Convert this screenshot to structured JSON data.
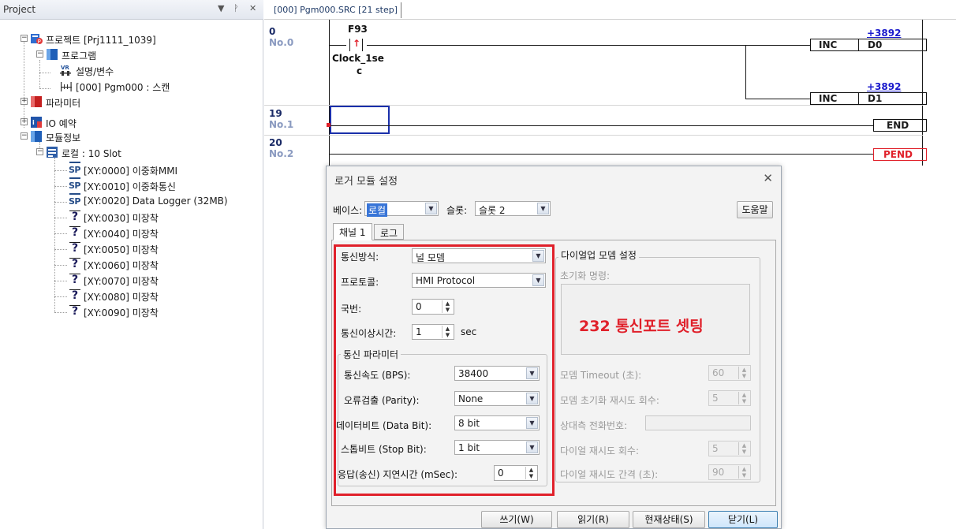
{
  "project_panel": {
    "title": "Project",
    "pin_glyph": "▾ ⊥ ✕",
    "tree": {
      "root": "프로젝트 [Prj1111_1039]",
      "program": "프로그램",
      "desc_vars": "설명/변수",
      "scan_program": "[000] Pgm000 : 스캔",
      "parameter": "파라미터",
      "io_reserve": "IO 예약",
      "module_info": "모듈정보",
      "local_base": "로컬 : 10 Slot",
      "slots": [
        {
          "label": "[XY:0000] 이중화MMI",
          "icon": "sp-module-icon"
        },
        {
          "label": "[XY:0010] 이중화통신",
          "icon": "sp-module-icon"
        },
        {
          "label": "[XY:0020] Data Logger (32MB)",
          "icon": "sp-module-icon"
        },
        {
          "label": "[XY:0030] 미장착",
          "icon": "unknown-module-icon"
        },
        {
          "label": "[XY:0040] 미장착",
          "icon": "unknown-module-icon"
        },
        {
          "label": "[XY:0050] 미장착",
          "icon": "unknown-module-icon"
        },
        {
          "label": "[XY:0060] 미장착",
          "icon": "unknown-module-icon"
        },
        {
          "label": "[XY:0070] 미장착",
          "icon": "unknown-module-icon"
        },
        {
          "label": "[XY:0080] 미장착",
          "icon": "unknown-module-icon"
        },
        {
          "label": "[XY:0090] 미장착",
          "icon": "unknown-module-icon"
        }
      ],
      "sp_glyph": "SP",
      "unknown_glyph": "?"
    }
  },
  "editor": {
    "tab_label": "[000] Pgm000.SRC [21 step]",
    "rungs": [
      {
        "step": "0",
        "no": "No.0"
      },
      {
        "step": "19",
        "no": "No.1"
      },
      {
        "step": "20",
        "no": "No.2"
      }
    ],
    "contact_name": "F93",
    "contact_glyph": "↑",
    "contact_comment_1": "Clock_1se",
    "contact_comment_2": "c",
    "inc1": {
      "addr": "+3892",
      "instr": "INC",
      "operand": "D0"
    },
    "inc2": {
      "addr": "+3892",
      "instr": "INC",
      "operand": "D1"
    },
    "end": "END",
    "pend": "PEND"
  },
  "dialog": {
    "title": "로거 모듈 설정",
    "close": "✕",
    "base_label": "베이스:",
    "base_value": "로컬",
    "slot_label": "슬롯:",
    "slot_value": "슬롯 2",
    "help_button": "도움말",
    "tabs": [
      "채널 1",
      "로그"
    ],
    "comm_method_label": "통신방식:",
    "comm_method_value": "널 모뎀",
    "protocol_label": "프로토콜:",
    "protocol_value": "HMI Protocol",
    "station_label": "국번:",
    "station_value": "0",
    "error_time_label": "통신이상시간:",
    "error_time_value": "1",
    "error_time_unit": "sec",
    "params_group": "통신 파라미터",
    "baud_label": "통신속도 (BPS):",
    "baud_value": "38400",
    "parity_label": "오류검출 (Parity):",
    "parity_value": "None",
    "databit_label": "데이터비트 (Data Bit):",
    "databit_value": "8 bit",
    "stopbit_label": "스톱비트 (Stop Bit):",
    "stopbit_value": "1 bit",
    "delay_label": "응답(송신) 지연시간 (mSec):",
    "delay_value": "0",
    "dialup_group": "다이얼업 모뎀 설정",
    "init_cmd_label": "초기화 명령:",
    "modem_timeout_label": "모뎀 Timeout (초):",
    "modem_timeout_value": "60",
    "modem_retry_label": "모뎀 초기화 재시도 회수:",
    "modem_retry_value": "5",
    "peer_phone_label": "상대측 전화번호:",
    "dial_retry_label": "다이얼 재시도 회수:",
    "dial_retry_value": "5",
    "dial_interval_label": "다이얼 재시도 간격 (초):",
    "dial_interval_value": "90",
    "overlay_text": "232 통신포트 셋팅",
    "buttons": {
      "write": "쓰기(W)",
      "read": "읽기(R)",
      "status": "현재상태(S)",
      "close": "닫기(L)"
    },
    "highlight_color": "#e0202a"
  }
}
